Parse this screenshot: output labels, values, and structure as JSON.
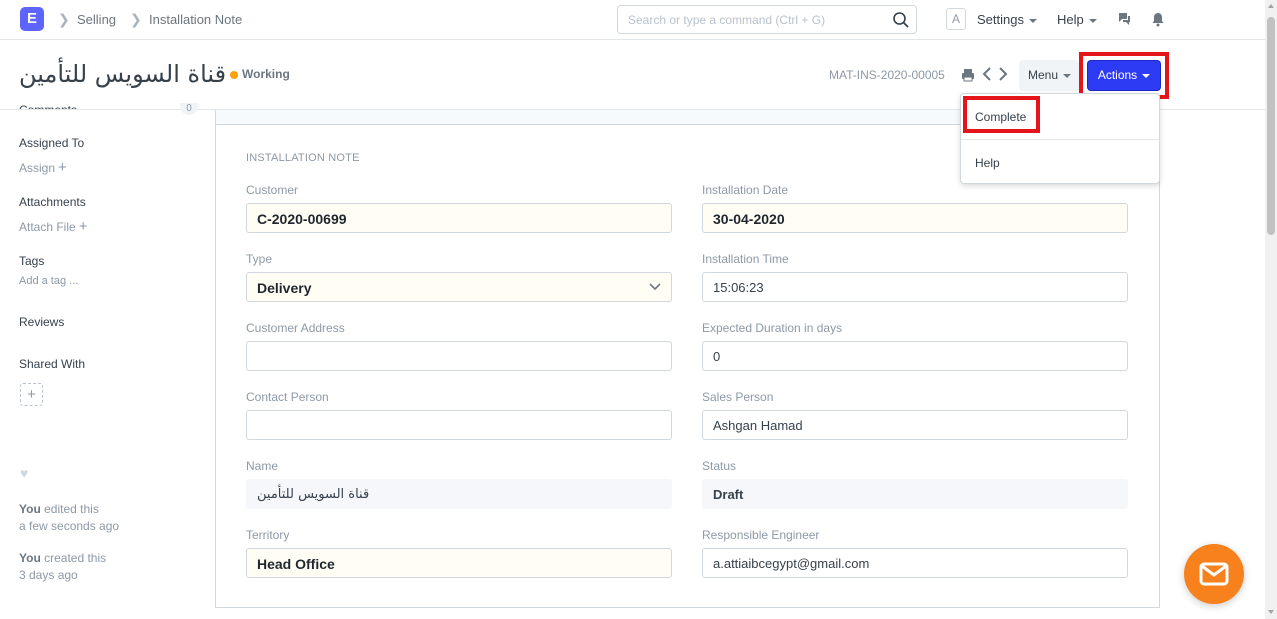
{
  "navbar": {
    "logo_letter": "E",
    "breadcrumbs": [
      "Selling",
      "Installation Note"
    ],
    "search_placeholder": "Search or type a command (Ctrl + G)",
    "avatar_letter": "A",
    "settings_label": "Settings",
    "help_label": "Help"
  },
  "page_head": {
    "title": "قناة السويس للتأمين",
    "status": "Working",
    "status_color": "#ffa00a",
    "doc_name": "MAT-INS-2020-00005",
    "menu_label": "Menu",
    "actions_label": "Actions"
  },
  "actions_dropdown": {
    "items": [
      "Complete",
      "Help"
    ]
  },
  "sidebar": {
    "comments_cut": "Comments",
    "comment_count": "0",
    "assigned_to": "Assigned To",
    "assign": "Assign",
    "attachments": "Attachments",
    "attach_file": "Attach File",
    "tags": "Tags",
    "add_tag": "Add a tag ...",
    "reviews": "Reviews",
    "shared_with": "Shared With",
    "activity": [
      {
        "user": "You",
        "action": " edited this",
        "time": "a few seconds ago"
      },
      {
        "user": "You",
        "action": " created this",
        "time": "3 days ago"
      }
    ]
  },
  "form": {
    "section_title": "INSTALLATION NOTE",
    "fields": {
      "customer": {
        "label": "Customer",
        "value": "C-2020-00699"
      },
      "installation_date": {
        "label": "Installation Date",
        "value": "30-04-2020"
      },
      "type": {
        "label": "Type",
        "value": "Delivery"
      },
      "installation_time": {
        "label": "Installation Time",
        "value": "15:06:23"
      },
      "customer_address": {
        "label": "Customer Address",
        "value": ""
      },
      "expected_duration": {
        "label": "Expected Duration in days",
        "value": "0"
      },
      "contact_person": {
        "label": "Contact Person",
        "value": ""
      },
      "sales_person": {
        "label": "Sales Person",
        "value": "Ashgan Hamad"
      },
      "name": {
        "label": "Name",
        "value": "قناة السويس للتأمين"
      },
      "status": {
        "label": "Status",
        "value": "Draft"
      },
      "territory": {
        "label": "Territory",
        "value": "Head Office"
      },
      "responsible_engineer": {
        "label": "Responsible Engineer",
        "value": "a.attiaibcegypt@gmail.com"
      }
    }
  }
}
